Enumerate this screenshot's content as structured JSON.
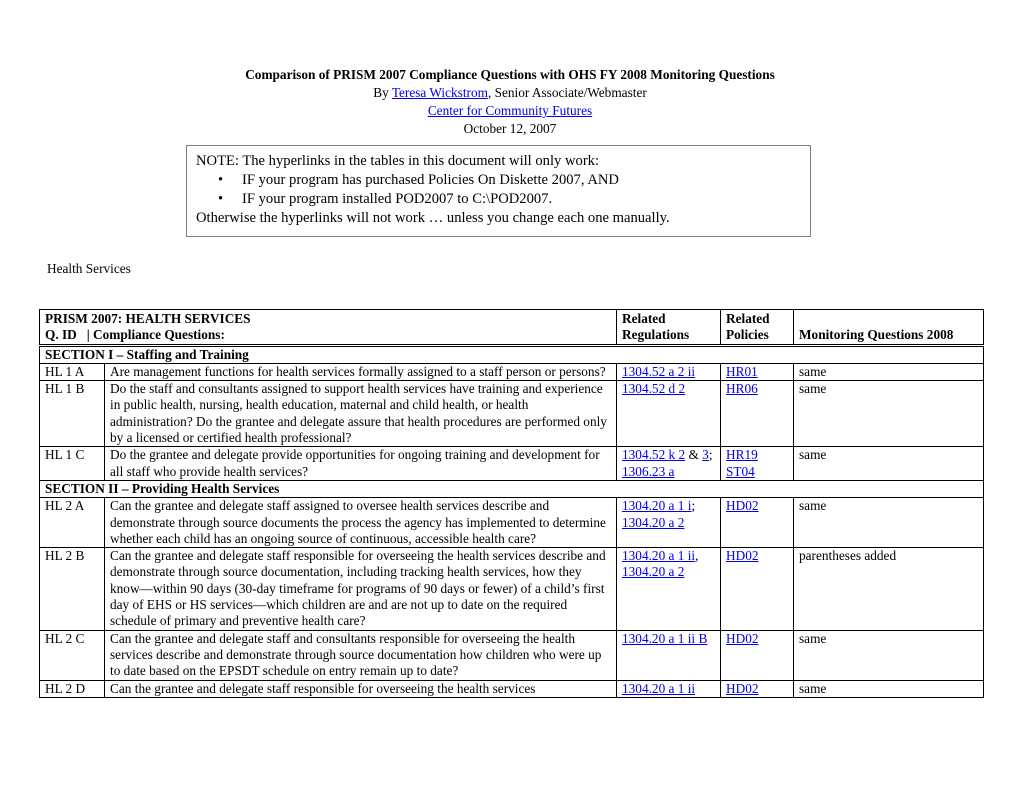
{
  "document": {
    "title": "Comparison of PRISM 2007 Compliance Questions with OHS FY 2008 Monitoring Questions",
    "byline_prefix": "By ",
    "author_link": "Teresa Wickstrom",
    "byline_suffix": ", Senior Associate/Webmaster",
    "org_link": "Center for Community Futures",
    "date": "October 12, 2007"
  },
  "note": {
    "intro": "NOTE: The hyperlinks in the tables in this document will only work:",
    "bullets": [
      "IF your program has purchased Policies On Diskette 2007, AND",
      "IF your program installed POD2007 to C:\\POD2007."
    ],
    "outro": "Otherwise the hyperlinks will not work … unless you change each one manually."
  },
  "section_label": "Health Services",
  "table": {
    "header": {
      "line1": "PRISM 2007: HEALTH SERVICES",
      "qid": "Q. ID",
      "separator": "|",
      "questions": "Compliance Questions:",
      "regs_1": "Related",
      "regs_2": "Regulations",
      "pol_1": "Related",
      "pol_2": "Policies",
      "monitoring": "Monitoring Questions 2008"
    },
    "sections": [
      {
        "title": "SECTION I – Staffing and Training",
        "rows": [
          {
            "id": "HL 1 A",
            "question": "Are management functions for health services formally assigned to a staff person or persons?",
            "regulations": [
              {
                "text": "1304.52 a 2 ii",
                "link": true
              }
            ],
            "policies": [
              {
                "text": "HR01"
              }
            ],
            "monitoring": "same"
          },
          {
            "id": "HL 1 B",
            "question": "Do the staff and consultants assigned to support health services have training and experience in public health, nursing, health education, maternal and child health, or health administration? Do the grantee and delegate assure that health procedures are performed only by a licensed or certified health professional?",
            "regulations": [
              {
                "text": "1304.52 d 2",
                "link": true
              }
            ],
            "policies": [
              {
                "text": "HR06"
              }
            ],
            "monitoring": "same"
          },
          {
            "id": "HL 1 C",
            "question": "Do the grantee and delegate provide opportunities for ongoing training and development for all staff who provide health services?",
            "regulations": [
              {
                "text": "1304.52 k 2",
                "link": true
              },
              {
                "text": " & ",
                "link": false
              },
              {
                "text": "3",
                "link": true
              },
              {
                "text": "; ",
                "link": false
              },
              {
                "text": "1306.23 a",
                "link": true
              }
            ],
            "policies": [
              {
                "text": "HR19"
              },
              {
                "text": "ST04"
              }
            ],
            "monitoring": "same"
          }
        ]
      },
      {
        "title": "SECTION II – Providing Health Services",
        "rows": [
          {
            "id": "HL 2 A",
            "question": "Can the grantee and delegate staff assigned to oversee health services describe and demonstrate through source documents the process the agency has implemented to determine whether each child has an ongoing source of continuous, accessible health care?",
            "regulations": [
              {
                "text": "1304.20 a 1 i",
                "link": true
              },
              {
                "text": "; ",
                "link": false
              },
              {
                "text": "1304.20 a 2",
                "link": true
              }
            ],
            "policies": [
              {
                "text": "HD02"
              }
            ],
            "monitoring": "same"
          },
          {
            "id": "HL 2 B",
            "question": "Can the grantee and delegate staff responsible for overseeing the health services describe and demonstrate through source documentation, including tracking health services, how they know—within 90 days (30-day timeframe for programs of 90 days or fewer) of a child’s first day of EHS or HS services—which children are and are not up to date on the required schedule of primary and preventive health care?",
            "regulations": [
              {
                "text": "1304.20 a 1 ii",
                "link": true
              },
              {
                "text": ", ",
                "link": false
              },
              {
                "text": "1304.20 a 2",
                "link": true
              }
            ],
            "policies": [
              {
                "text": "HD02"
              }
            ],
            "monitoring": "parentheses added"
          },
          {
            "id": "HL 2 C",
            "question": "Can the grantee and delegate staff and consultants responsible for overseeing the health services describe and demonstrate through source documentation how children who were up to date based on the EPSDT schedule on entry remain up to date?",
            "regulations": [
              {
                "text": "1304.20 a 1 ii B",
                "link": true
              }
            ],
            "policies": [
              {
                "text": "HD02"
              }
            ],
            "monitoring": "same"
          },
          {
            "id": "HL 2 D",
            "question": "Can the grantee and delegate staff responsible for overseeing the health services",
            "regulations": [
              {
                "text": "1304.20 a 1 ii",
                "link": true
              }
            ],
            "policies": [
              {
                "text": "HD02"
              }
            ],
            "monitoring": "same"
          }
        ]
      }
    ]
  }
}
